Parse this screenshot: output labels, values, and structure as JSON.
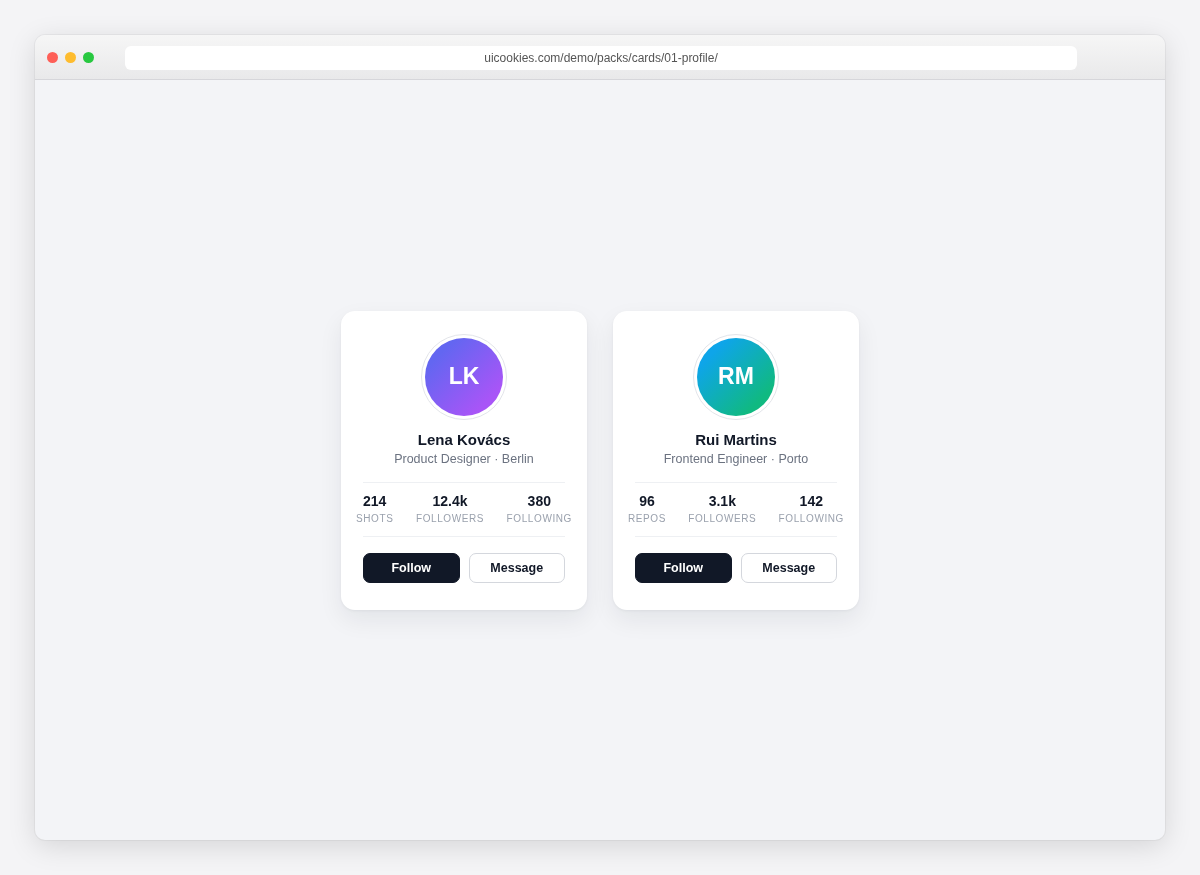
{
  "browser": {
    "address": "uicookies.com/demo/packs/cards/01-profile/"
  },
  "cards": [
    {
      "avatar": {
        "initials": "LK",
        "gradient": [
          {
            "color": "#6366f1"
          },
          {
            "color": "#a855f7"
          }
        ]
      },
      "name": "Lena Kovács",
      "subtitle": "Product Designer · Berlin",
      "stats": [
        {
          "value": "214",
          "label": "SHOTS"
        },
        {
          "value": "12.4k",
          "label": "FOLLOWERS"
        },
        {
          "value": "380",
          "label": "FOLLOWING"
        }
      ],
      "actions": [
        {
          "label": "Follow",
          "kind": "primary"
        },
        {
          "label": "Message",
          "kind": "secondary"
        }
      ]
    },
    {
      "avatar": {
        "initials": "RM",
        "gradient": [
          {
            "color": "#0ea5e9"
          },
          {
            "color": "#10b981"
          }
        ]
      },
      "name": "Rui Martins",
      "subtitle": "Frontend Engineer · Porto",
      "stats": [
        {
          "value": "96",
          "label": "REPOS"
        },
        {
          "value": "3.1k",
          "label": "FOLLOWERS"
        },
        {
          "value": "142",
          "label": "FOLLOWING"
        }
      ],
      "actions": [
        {
          "label": "Follow",
          "kind": "primary"
        },
        {
          "label": "Message",
          "kind": "secondary"
        }
      ]
    }
  ]
}
